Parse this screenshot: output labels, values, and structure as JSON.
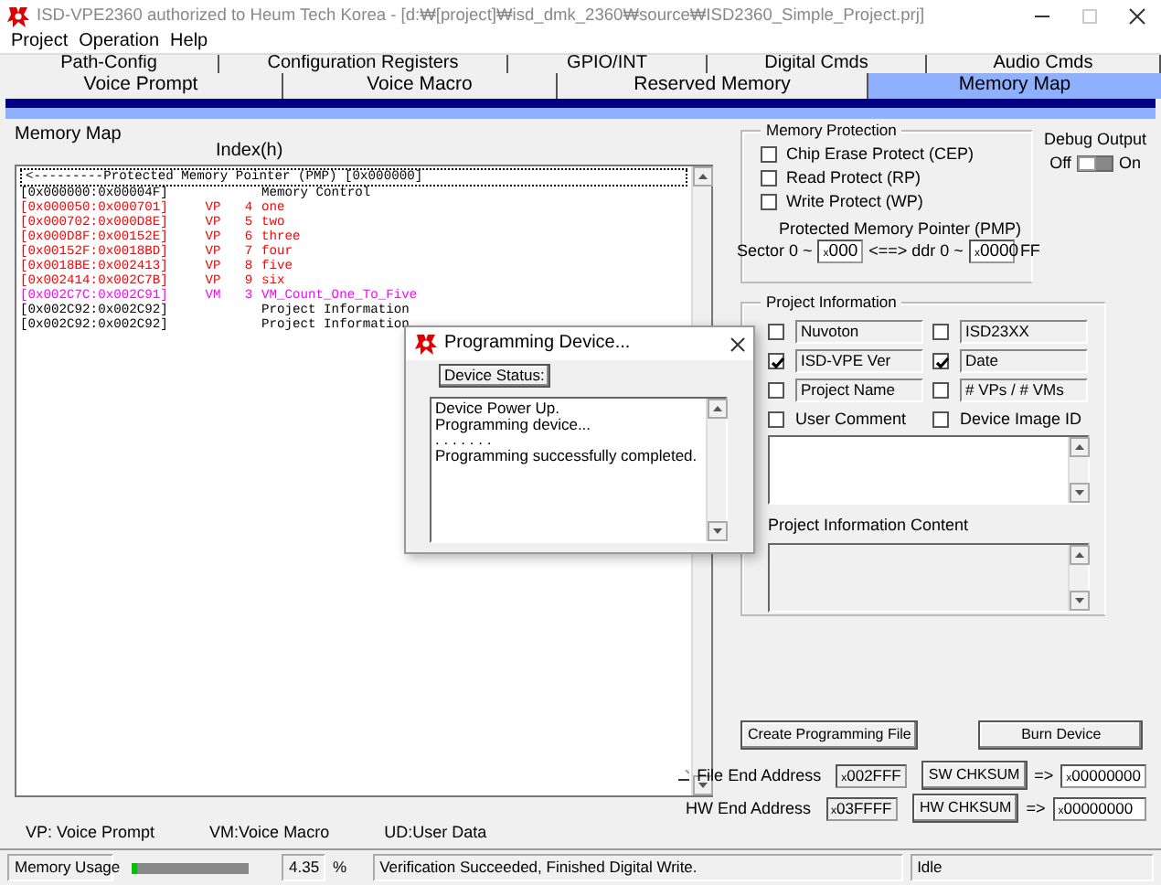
{
  "window": {
    "title": "ISD-VPE2360 authorized to Heum Tech Korea - [d:₩[project]₩isd_dmk_2360₩source₩ISD2360_Simple_Project.prj]"
  },
  "menu": [
    "Project",
    "Operation",
    "Help"
  ],
  "tabs_upper": [
    {
      "label": "Path-Config",
      "selected": false
    },
    {
      "label": "Configuration Registers",
      "selected": false
    },
    {
      "label": "GPIO/INT",
      "selected": false
    },
    {
      "label": "Digital Cmds",
      "selected": false
    },
    {
      "label": "Audio Cmds",
      "selected": false
    }
  ],
  "tabs_lower": [
    {
      "label": "Voice Prompt",
      "selected": false
    },
    {
      "label": "Voice Macro",
      "selected": false
    },
    {
      "label": "Reserved Memory",
      "selected": false
    },
    {
      "label": "Memory Map",
      "selected": true
    }
  ],
  "memory_map": {
    "label": "Memory Map",
    "index_header": "Index(h)",
    "header_row": {
      "text": "<---------Protected Memory Pointer (PMP) [0x000000]",
      "selected": true
    },
    "rows": [
      {
        "address": "[0x000000:0x00004F]",
        "name": "Memory Control",
        "color": "#000000"
      },
      {
        "address": "[0x000050:0x000701]",
        "type": "VP",
        "index": "4",
        "name": "one",
        "color": "#ff0000"
      },
      {
        "address": "[0x000702:0x000D8E]",
        "type": "VP",
        "index": "5",
        "name": "two",
        "color": "#ff0000"
      },
      {
        "address": "[0x000D8F:0x00152E]",
        "type": "VP",
        "index": "6",
        "name": "three",
        "color": "#ff0000"
      },
      {
        "address": "[0x00152F:0x0018BD]",
        "type": "VP",
        "index": "7",
        "name": "four",
        "color": "#ff0000"
      },
      {
        "address": "[0x0018BE:0x002413]",
        "type": "VP",
        "index": "8",
        "name": "five",
        "color": "#ff0000"
      },
      {
        "address": "[0x002414:0x002C7B]",
        "type": "VP",
        "index": "9",
        "name": "six",
        "color": "#ff0000"
      },
      {
        "address": "[0x002C7C:0x002C91]",
        "type": "VM",
        "index": "3",
        "name": "VM_Count_One_To_Five",
        "color": "#ff00ff"
      },
      {
        "address": "[0x002C92:0x002C92]",
        "name": "Project Information",
        "color": "#000000"
      },
      {
        "address": "[0x002C92:0x002C92]",
        "name": "Project Information",
        "color": "#000000"
      }
    ]
  },
  "legend": [
    "VP: Voice Prompt",
    "VM:Voice Macro",
    "UD:User Data"
  ],
  "memory_protection": {
    "title": "Memory Protection",
    "options": [
      {
        "label": "Chip Erase Protect (CEP)",
        "checked": false
      },
      {
        "label": "Read Protect (RP)",
        "checked": false
      },
      {
        "label": "Write Protect (WP)",
        "checked": false
      }
    ],
    "pmp_label": "Protected Memory Pointer (PMP)",
    "sector_label": "Sector 0 ~",
    "sector_field": {
      "prefix": "x",
      "value": "000"
    },
    "ddr_label": "<==> ddr 0 ~",
    "ddr_field": {
      "prefix": "x",
      "value": "0000"
    },
    "suffix": "FF"
  },
  "debug_output": {
    "label": "Debug Output",
    "off_label": "Off",
    "on_label": "On",
    "on": false
  },
  "project_information": {
    "title": "Project Information",
    "fields": [
      {
        "label": "Nuvoton",
        "checked": false
      },
      {
        "label": "ISD23XX",
        "checked": false
      },
      {
        "label": "ISD-VPE Ver",
        "checked": true
      },
      {
        "label": "Date",
        "checked": true
      },
      {
        "label": "Project Name",
        "checked": false
      },
      {
        "label": "# VPs / # VMs",
        "checked": false
      }
    ],
    "options": [
      {
        "label": "User Comment",
        "checked": false
      },
      {
        "label": "Device Image ID",
        "checked": false
      }
    ],
    "content_label": "Project Information Content"
  },
  "actions": [
    "Create Programming File",
    "Burn Device"
  ],
  "addresses": [
    {
      "label": "File End Address",
      "prefix": "x",
      "value": "002FFF",
      "button": "SW CHKSUM",
      "arrow": "=>",
      "result_prefix": "x",
      "result": "00000000"
    },
    {
      "label": "HW End Address",
      "prefix": "x",
      "value": "03FFFF",
      "button": "HW CHKSUM",
      "arrow": "=>",
      "result_prefix": "x",
      "result": "00000000"
    }
  ],
  "status_bar": {
    "memory_label": "Memory Usage",
    "level": 0.04,
    "percent": "4.35",
    "percent_sign": "%",
    "message": "Verification Succeeded, Finished Digital Write.",
    "state": "Idle"
  },
  "dialog": {
    "title": "Programming Device...",
    "status_button": "Device Status:",
    "log": [
      "Device Power Up.",
      "Programming device...",
      ". . . . . . .",
      "Programming successfully completed."
    ]
  }
}
